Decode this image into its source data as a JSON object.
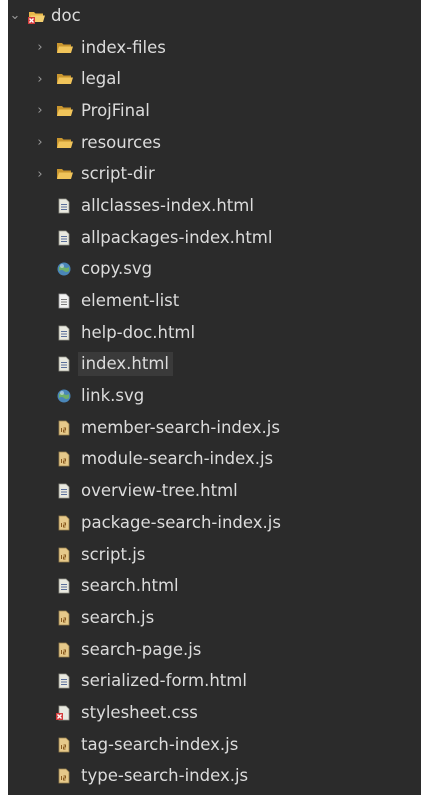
{
  "tree": {
    "root": {
      "label": "doc",
      "expanded": true,
      "icon": "folder-error-icon"
    },
    "items": [
      {
        "label": "index-files",
        "type": "folder",
        "icon": "folder-icon"
      },
      {
        "label": "legal",
        "type": "folder",
        "icon": "folder-icon"
      },
      {
        "label": "ProjFinal",
        "type": "folder",
        "icon": "folder-icon"
      },
      {
        "label": "resources",
        "type": "folder",
        "icon": "folder-icon"
      },
      {
        "label": "script-dir",
        "type": "folder",
        "icon": "folder-icon"
      },
      {
        "label": "allclasses-index.html",
        "type": "file",
        "icon": "html-file-icon"
      },
      {
        "label": "allpackages-index.html",
        "type": "file",
        "icon": "html-file-icon"
      },
      {
        "label": "copy.svg",
        "type": "file",
        "icon": "svg-globe-icon"
      },
      {
        "label": "element-list",
        "type": "file",
        "icon": "text-file-icon"
      },
      {
        "label": "help-doc.html",
        "type": "file",
        "icon": "html-file-icon"
      },
      {
        "label": "index.html",
        "type": "file",
        "icon": "html-file-icon",
        "selected": true
      },
      {
        "label": "link.svg",
        "type": "file",
        "icon": "svg-globe-icon"
      },
      {
        "label": "member-search-index.js",
        "type": "file",
        "icon": "js-file-icon"
      },
      {
        "label": "module-search-index.js",
        "type": "file",
        "icon": "js-file-icon"
      },
      {
        "label": "overview-tree.html",
        "type": "file",
        "icon": "html-file-icon"
      },
      {
        "label": "package-search-index.js",
        "type": "file",
        "icon": "js-file-icon"
      },
      {
        "label": "script.js",
        "type": "file",
        "icon": "js-file-icon"
      },
      {
        "label": "search.html",
        "type": "file",
        "icon": "html-file-icon"
      },
      {
        "label": "search.js",
        "type": "file",
        "icon": "js-file-icon"
      },
      {
        "label": "search-page.js",
        "type": "file",
        "icon": "js-file-icon"
      },
      {
        "label": "serialized-form.html",
        "type": "file",
        "icon": "html-file-icon"
      },
      {
        "label": "stylesheet.css",
        "type": "file",
        "icon": "css-error-file-icon"
      },
      {
        "label": "tag-search-index.js",
        "type": "file",
        "icon": "js-file-icon"
      },
      {
        "label": "type-search-index.js",
        "type": "file",
        "icon": "js-file-icon"
      }
    ]
  },
  "colors": {
    "background": "#2b2b2b",
    "text": "#dcdcdc",
    "folder": "#e8b84a",
    "selection": "#3a3a3a",
    "error": "#d23c3c"
  }
}
